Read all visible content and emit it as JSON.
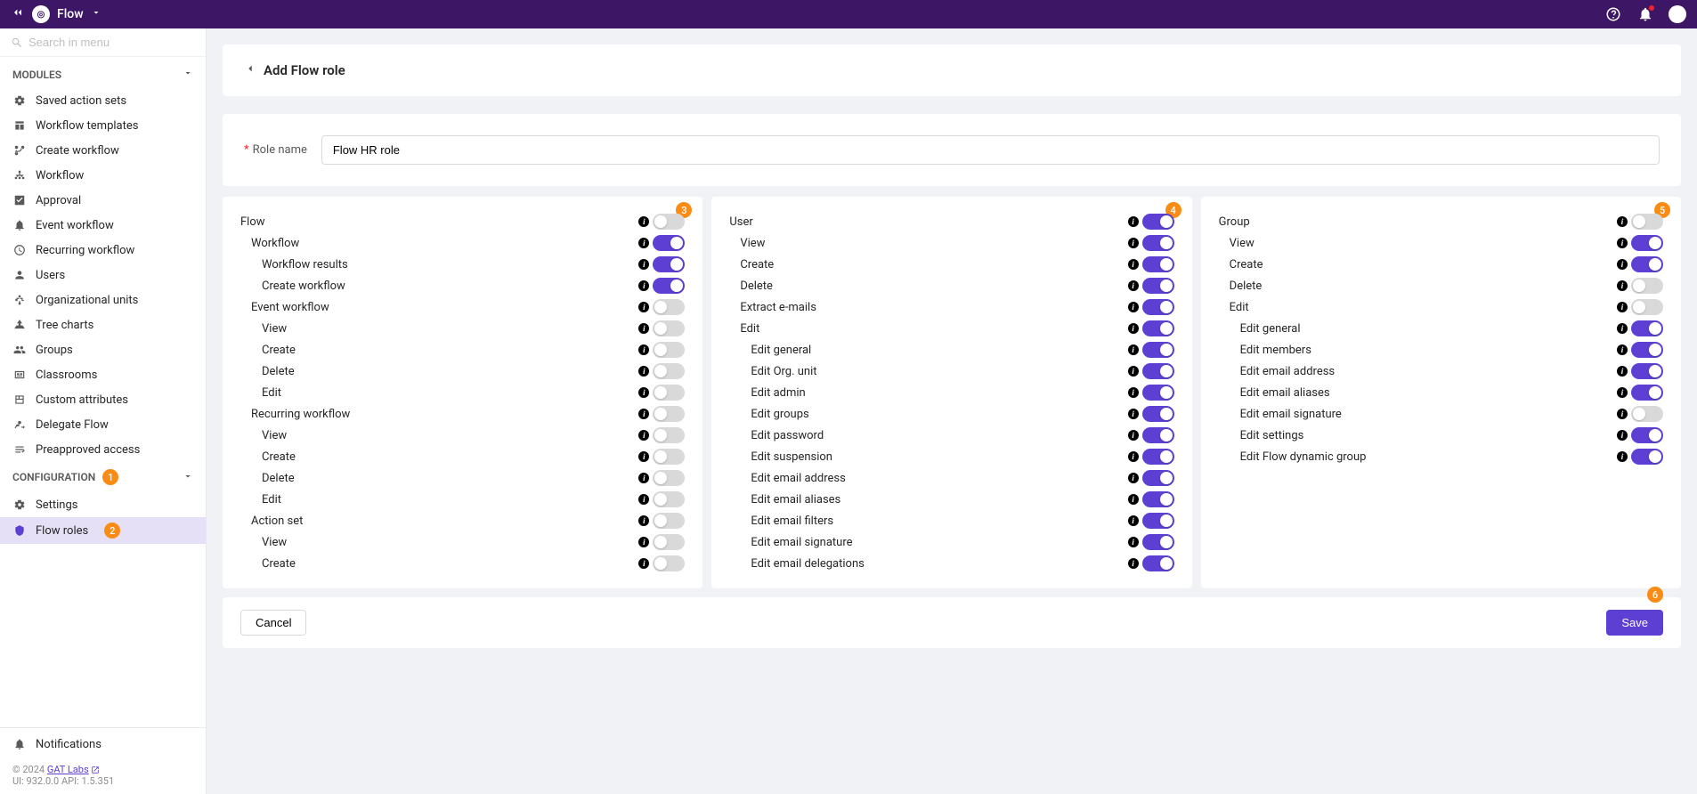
{
  "header": {
    "app_name": "Flow"
  },
  "search": {
    "placeholder": "Search in menu"
  },
  "sidebar": {
    "modules_label": "MODULES",
    "config_label": "CONFIGURATION",
    "modules": [
      {
        "label": "Saved action sets",
        "icon": "gear"
      },
      {
        "label": "Workflow templates",
        "icon": "template"
      },
      {
        "label": "Create workflow",
        "icon": "branch"
      },
      {
        "label": "Workflow",
        "icon": "sitemap"
      },
      {
        "label": "Approval",
        "icon": "check"
      },
      {
        "label": "Event workflow",
        "icon": "bell"
      },
      {
        "label": "Recurring workflow",
        "icon": "clock"
      },
      {
        "label": "Users",
        "icon": "user"
      },
      {
        "label": "Organizational units",
        "icon": "org"
      },
      {
        "label": "Tree charts",
        "icon": "tree"
      },
      {
        "label": "Groups",
        "icon": "group"
      },
      {
        "label": "Classrooms",
        "icon": "class"
      },
      {
        "label": "Custom attributes",
        "icon": "attr"
      },
      {
        "label": "Delegate Flow",
        "icon": "delegate"
      },
      {
        "label": "Preapproved access",
        "icon": "access"
      }
    ],
    "config": [
      {
        "label": "Settings",
        "icon": "settings",
        "active": false
      },
      {
        "label": "Flow roles",
        "icon": "shield",
        "active": true
      }
    ],
    "notifications_label": "Notifications",
    "copyright": "© 2024 ",
    "copyright_link": "GAT Labs",
    "version": "UI: 932.0.0 API: 1.5.351"
  },
  "page": {
    "title": "Add Flow role",
    "role_name_label": "Role name",
    "role_name_value": "Flow HR role",
    "cancel_label": "Cancel",
    "save_label": "Save"
  },
  "badges": {
    "config": "1",
    "flow_roles": "2",
    "card_flow": "3",
    "card_user": "4",
    "card_group": "5",
    "save": "6"
  },
  "perm_flow": {
    "title": "Flow",
    "rows": [
      {
        "label": "Flow",
        "level": 0,
        "on": false
      },
      {
        "label": "Workflow",
        "level": 1,
        "on": true
      },
      {
        "label": "Workflow results",
        "level": 2,
        "on": true
      },
      {
        "label": "Create workflow",
        "level": 2,
        "on": true
      },
      {
        "label": "Event workflow",
        "level": 1,
        "on": false
      },
      {
        "label": "View",
        "level": 2,
        "on": false
      },
      {
        "label": "Create",
        "level": 2,
        "on": false
      },
      {
        "label": "Delete",
        "level": 2,
        "on": false
      },
      {
        "label": "Edit",
        "level": 2,
        "on": false
      },
      {
        "label": "Recurring workflow",
        "level": 1,
        "on": false
      },
      {
        "label": "View",
        "level": 2,
        "on": false
      },
      {
        "label": "Create",
        "level": 2,
        "on": false
      },
      {
        "label": "Delete",
        "level": 2,
        "on": false
      },
      {
        "label": "Edit",
        "level": 2,
        "on": false
      },
      {
        "label": "Action set",
        "level": 1,
        "on": false
      },
      {
        "label": "View",
        "level": 2,
        "on": false
      },
      {
        "label": "Create",
        "level": 2,
        "on": false
      }
    ]
  },
  "perm_user": {
    "title": "User",
    "rows": [
      {
        "label": "User",
        "level": 0,
        "on": true
      },
      {
        "label": "View",
        "level": 1,
        "on": true
      },
      {
        "label": "Create",
        "level": 1,
        "on": true
      },
      {
        "label": "Delete",
        "level": 1,
        "on": true
      },
      {
        "label": "Extract e-mails",
        "level": 1,
        "on": true
      },
      {
        "label": "Edit",
        "level": 1,
        "on": true
      },
      {
        "label": "Edit general",
        "level": 2,
        "on": true
      },
      {
        "label": "Edit Org. unit",
        "level": 2,
        "on": true
      },
      {
        "label": "Edit admin",
        "level": 2,
        "on": true
      },
      {
        "label": "Edit groups",
        "level": 2,
        "on": true
      },
      {
        "label": "Edit password",
        "level": 2,
        "on": true
      },
      {
        "label": "Edit suspension",
        "level": 2,
        "on": true
      },
      {
        "label": "Edit email address",
        "level": 2,
        "on": true
      },
      {
        "label": "Edit email aliases",
        "level": 2,
        "on": true
      },
      {
        "label": "Edit email filters",
        "level": 2,
        "on": true
      },
      {
        "label": "Edit email signature",
        "level": 2,
        "on": true
      },
      {
        "label": "Edit email delegations",
        "level": 2,
        "on": true
      }
    ]
  },
  "perm_group": {
    "title": "Group",
    "rows": [
      {
        "label": "Group",
        "level": 0,
        "on": false
      },
      {
        "label": "View",
        "level": 1,
        "on": true
      },
      {
        "label": "Create",
        "level": 1,
        "on": true
      },
      {
        "label": "Delete",
        "level": 1,
        "on": false
      },
      {
        "label": "Edit",
        "level": 1,
        "on": false
      },
      {
        "label": "Edit general",
        "level": 2,
        "on": true
      },
      {
        "label": "Edit members",
        "level": 2,
        "on": true
      },
      {
        "label": "Edit email address",
        "level": 2,
        "on": true
      },
      {
        "label": "Edit email aliases",
        "level": 2,
        "on": true
      },
      {
        "label": "Edit email signature",
        "level": 2,
        "on": false
      },
      {
        "label": "Edit settings",
        "level": 2,
        "on": true
      },
      {
        "label": "Edit Flow dynamic group",
        "level": 2,
        "on": true
      }
    ]
  }
}
